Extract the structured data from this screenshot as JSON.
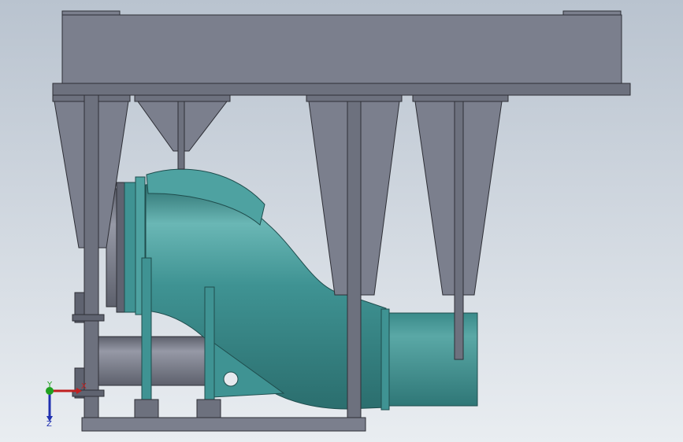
{
  "viewport": {
    "background_top": "#b9c3cf",
    "background_bottom": "#e9edf1"
  },
  "colors": {
    "frame_steel": "#7b7f8d",
    "frame_steel_dark": "#5f6370",
    "frame_edge": "#2e2f36",
    "duct_teal": "#3f9393",
    "duct_teal_light": "#6ab7b5",
    "duct_teal_dark": "#2b6e6e",
    "inlet_pipe": "#6f7280",
    "inlet_pipe_light": "#9699a6"
  },
  "model": {
    "parts": [
      "top-support-frame",
      "hopper-1",
      "hopper-2",
      "hopper-3",
      "hopper-4",
      "teal-transition-duct",
      "base-plate",
      "lower-inlet-pipe",
      "upper-inlet-pipe"
    ]
  },
  "triad": {
    "x_label": "X",
    "y_label": "Y",
    "z_label": "Z",
    "x_color": "#c02020",
    "y_color": "#20a020",
    "z_color": "#2030b0",
    "icon": "coordinate-triad-icon"
  }
}
